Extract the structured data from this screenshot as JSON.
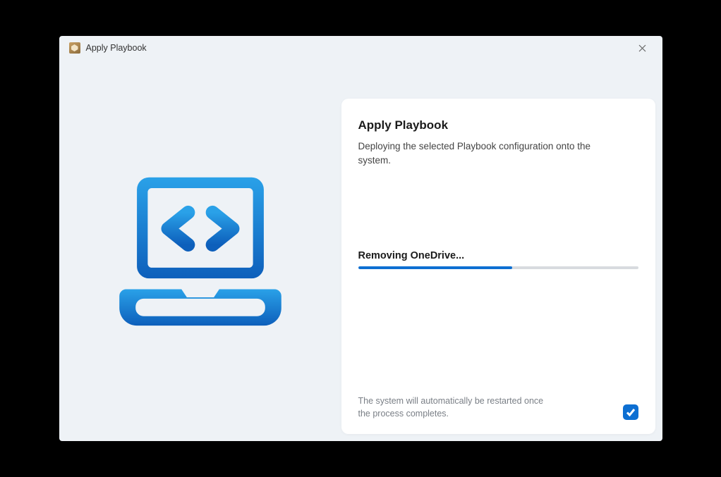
{
  "window": {
    "title": "Apply Playbook"
  },
  "panel": {
    "heading": "Apply Playbook",
    "subtitle": "Deploying the selected Playbook configuration onto the system.",
    "status": "Removing OneDrive...",
    "progress_percent": 55,
    "restart_note": "The system will automatically be restarted once the process completes.",
    "restart_checked": true
  },
  "colors": {
    "accent": "#0d6fd2"
  }
}
